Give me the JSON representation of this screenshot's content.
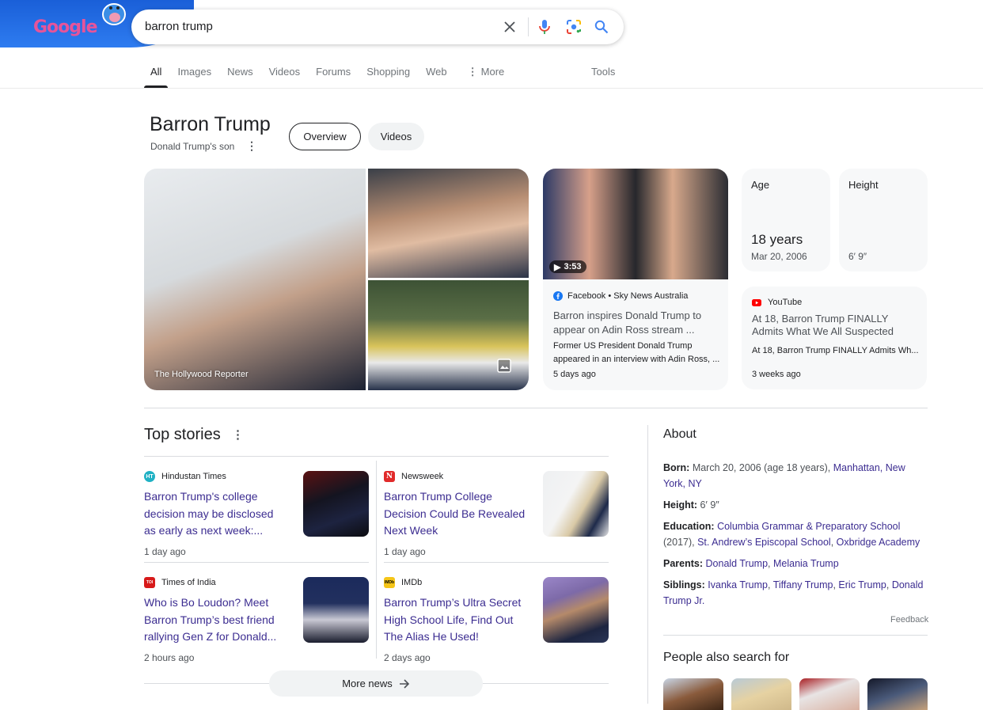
{
  "header": {
    "logo_text": "Google",
    "search_query": "barron trump",
    "icons": {
      "clear": "close-icon",
      "voice": "microphone-icon",
      "lens": "camera-lens-icon",
      "search": "search-icon"
    }
  },
  "tabs": {
    "items": [
      {
        "label": "All",
        "active": true
      },
      {
        "label": "Images"
      },
      {
        "label": "News"
      },
      {
        "label": "Videos"
      },
      {
        "label": "Forums"
      },
      {
        "label": "Shopping"
      },
      {
        "label": "Web"
      },
      {
        "label": "More"
      }
    ],
    "tools_label": "Tools"
  },
  "entity": {
    "title": "Barron Trump",
    "subtitle": "Donald Trump's son",
    "pills": [
      "Overview",
      "Videos"
    ]
  },
  "images": {
    "caption": "The Hollywood Reporter"
  },
  "video_card": {
    "duration": "3:53",
    "source": "Facebook • Sky News Australia",
    "title": "Barron inspires Donald Trump to appear on Adin Ross stream ...",
    "description": "Former US President Donald Trump appeared in an interview with Adin Ross, ...",
    "time": "5 days ago"
  },
  "facts": {
    "age": {
      "label": "Age",
      "value": "18 years",
      "sub": "Mar 20, 2006"
    },
    "height": {
      "label": "Height",
      "sub": "6′ 9″"
    }
  },
  "youtube_card": {
    "source": "YouTube",
    "title": "At 18, Barron Trump FINALLY Admits What We All Suspected",
    "description": "At 18, Barron Trump FINALLY Admits Wh...",
    "time": "3 weeks ago"
  },
  "top_stories": {
    "title": "Top stories",
    "items": [
      {
        "source": "Hindustan Times",
        "favicon": "HT",
        "headline": "Barron Trump's college decision may be disclosed as early as next week:...",
        "time": "1 day ago"
      },
      {
        "source": "Newsweek",
        "favicon": "N",
        "headline": "Barron Trump College Decision Could Be Revealed Next Week",
        "time": "1 day ago"
      },
      {
        "source": "Times of India",
        "favicon": "TOI",
        "headline": "Who is Bo Loudon? Meet Barron Trump’s best friend rallying Gen Z for Donald...",
        "time": "2 hours ago"
      },
      {
        "source": "IMDb",
        "favicon": "IMDb",
        "headline": "Barron Trump’s Ultra Secret High School Life, Find Out The Alias He Used!",
        "time": "2 days ago"
      }
    ],
    "more_news_label": "More news"
  },
  "about": {
    "title": "About",
    "born_label": "Born:",
    "born_text": "March 20, 2006 (age 18 years),",
    "born_link": "Manhattan, New York, NY",
    "height_label": "Height:",
    "height_text": "6′ 9″",
    "education_label": "Education:",
    "education_link1": "Columbia Grammar & Preparatory School",
    "education_text": "(2017),",
    "education_link2": "St. Andrew’s Episcopal School",
    "education_link3": "Oxbridge Academy",
    "parents_label": "Parents:",
    "parents_link1": "Donald Trump",
    "parents_link2": "Melania Trump",
    "siblings_label": "Siblings:",
    "siblings_link1": "Ivanka Trump",
    "siblings_link2": "Tiffany Trump",
    "siblings_link3": "Eric Trump",
    "siblings_link4": "Donald Trump Jr.",
    "feedback": "Feedback"
  },
  "people_also_search": {
    "title": "People also search for"
  },
  "colors": {
    "link": "#3c2d91",
    "text": "#202124",
    "muted": "#4d5156",
    "card_bg": "#f7f8f9",
    "doodle_blue": "#2e7cf0"
  }
}
